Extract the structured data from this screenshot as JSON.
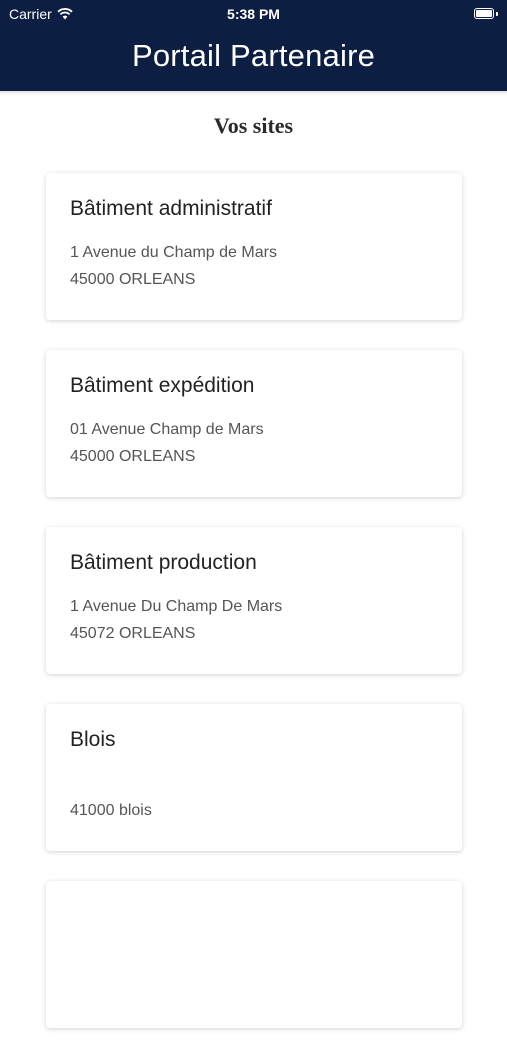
{
  "status_bar": {
    "carrier": "Carrier",
    "time": "5:38 PM",
    "wifi_icon": "wifi-icon",
    "battery_icon": "battery-icon"
  },
  "header": {
    "title": "Portail Partenaire",
    "background": "#0c1f42"
  },
  "section": {
    "title": "Vos sites"
  },
  "sites": [
    {
      "name": "Bâtiment administratif",
      "address": "1 Avenue du Champ de Mars",
      "city": "45000 ORLEANS"
    },
    {
      "name": "Bâtiment expédition",
      "address": "01 Avenue Champ de Mars",
      "city": "45000 ORLEANS"
    },
    {
      "name": "Bâtiment production",
      "address": "1 Avenue Du Champ De Mars",
      "city": "45072 ORLEANS"
    },
    {
      "name": "Blois",
      "address": "",
      "city": "41000 blois"
    },
    {
      "name": "",
      "address": "",
      "city": ""
    }
  ]
}
